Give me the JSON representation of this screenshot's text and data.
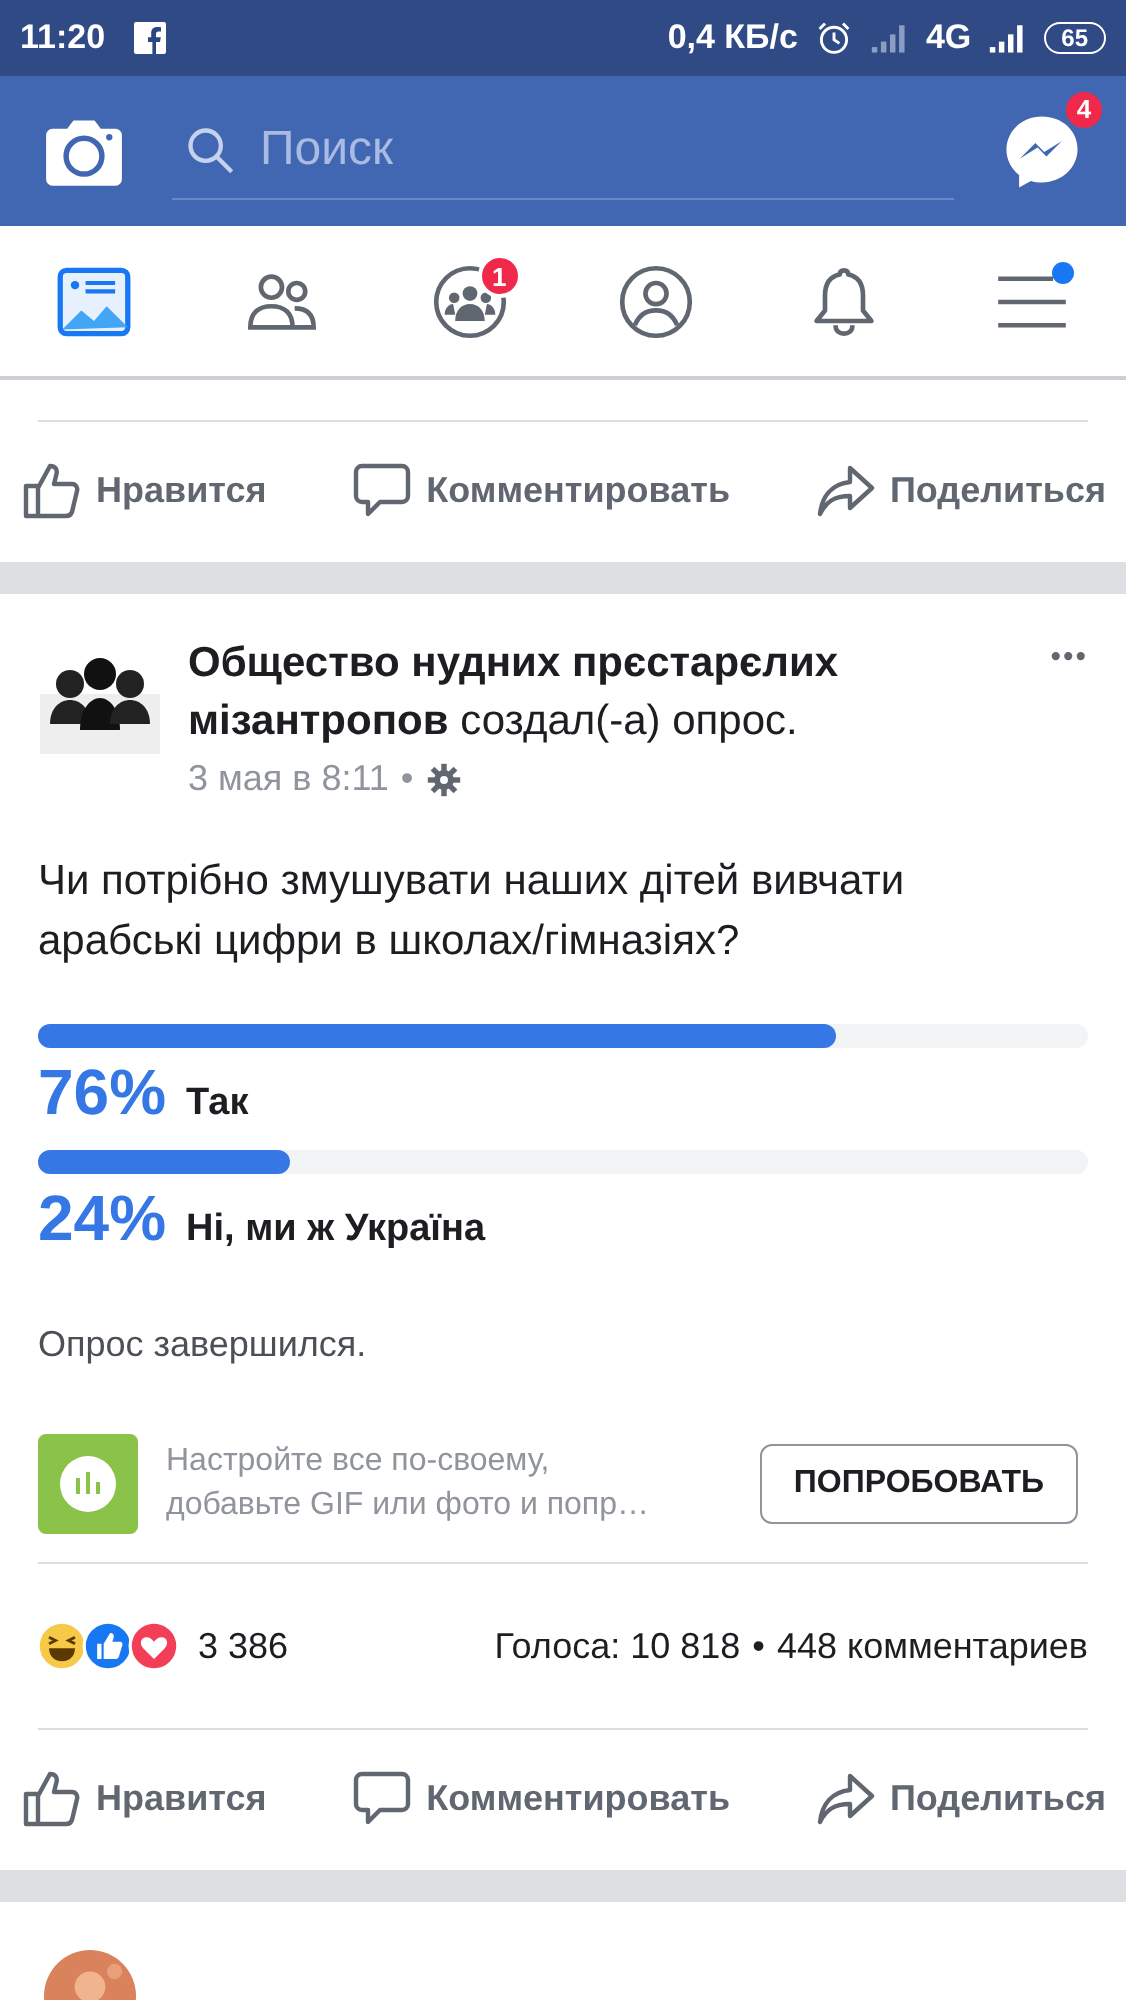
{
  "status_bar": {
    "time": "11:20",
    "speed": "0,4 КБ/с",
    "network": "4G",
    "battery": "65"
  },
  "header": {
    "search": {
      "placeholder": "Поиск"
    },
    "messenger_badge": "4"
  },
  "nav_tabs": [
    {
      "kind": "feed",
      "selected": true
    },
    {
      "kind": "friends",
      "selected": false
    },
    {
      "kind": "groups",
      "selected": false,
      "badge": "1"
    },
    {
      "kind": "profile",
      "selected": false
    },
    {
      "kind": "notifications",
      "selected": false
    },
    {
      "kind": "menu",
      "selected": false,
      "dot": true
    }
  ],
  "previous_post": {
    "actions": [
      {
        "kind": "like",
        "label": "Нравится"
      },
      {
        "kind": "comment",
        "label": "Комментировать"
      },
      {
        "kind": "share",
        "label": "Поделиться"
      }
    ]
  },
  "post": {
    "author": "Общество нудних прєстарєлих мізантропов",
    "action": "создал(-а) опрос.",
    "time": "3 мая в 8:11",
    "time_separator": "•",
    "more": "•••",
    "question": "Чи потрібно змушувати наших дітей вивчати арабські цифри в школах/гімназіях?",
    "options": [
      {
        "percent": "76%",
        "label": "Так",
        "level": 0.76
      },
      {
        "percent": "24%",
        "label": "Ні, ми ж Україна",
        "level": 0.24
      }
    ],
    "poll_status": "Опрос завершился.",
    "promo": {
      "text": "Настройте все по-своему, добавьте GIF или фото и попр…",
      "button": "ПОПРОБОВАТЬ"
    },
    "reactions": [
      {
        "kind": "haha"
      },
      {
        "kind": "like"
      },
      {
        "kind": "love"
      }
    ],
    "reaction_count": "3 386",
    "votes": "Голоса: 10 818",
    "stats_separator": "•",
    "comments": "448 комментариев",
    "actions": [
      {
        "kind": "like",
        "label": "Нравится"
      },
      {
        "kind": "comment",
        "label": "Комментировать"
      },
      {
        "kind": "share",
        "label": "Поделиться"
      }
    ]
  }
}
